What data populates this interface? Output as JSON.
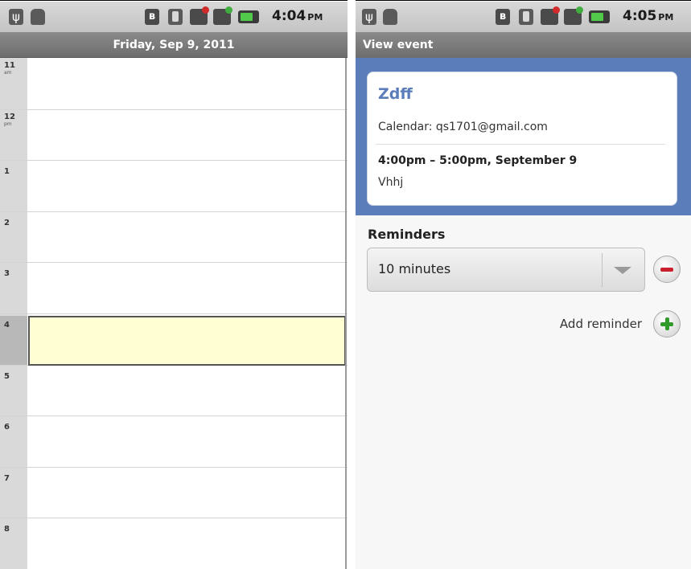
{
  "left_screen": {
    "status_bar": {
      "time": "4:04",
      "ampm": "PM",
      "icons": [
        "usb-icon",
        "android-debug-icon",
        "bluetooth-icon",
        "vibrate-icon",
        "signal-alert-icon",
        "signal-icon",
        "battery-icon"
      ]
    },
    "day_title": "Friday, Sep 9, 2011",
    "hours": [
      {
        "label": "11",
        "sub": "am"
      },
      {
        "label": "12",
        "sub": "pm"
      },
      {
        "label": "1",
        "sub": ""
      },
      {
        "label": "2",
        "sub": ""
      },
      {
        "label": "3",
        "sub": ""
      },
      {
        "label": "4",
        "sub": ""
      },
      {
        "label": "5",
        "sub": ""
      },
      {
        "label": "6",
        "sub": ""
      },
      {
        "label": "7",
        "sub": ""
      },
      {
        "label": "8",
        "sub": ""
      }
    ]
  },
  "right_screen": {
    "status_bar": {
      "time": "4:05",
      "ampm": "PM"
    },
    "title": "View event",
    "event": {
      "title": "Zdff",
      "calendar": "Calendar: qs1701@gmail.com",
      "time": "4:00pm – 5:00pm, September 9",
      "location": "Vhhj"
    },
    "reminders": {
      "label": "Reminders",
      "selected": "10 minutes",
      "add_label": "Add reminder"
    }
  },
  "colors": {
    "accent": "#5b7db9",
    "selected_slot": "#ffffd3",
    "remove": "#c8202c",
    "add": "#2f9a2a"
  }
}
